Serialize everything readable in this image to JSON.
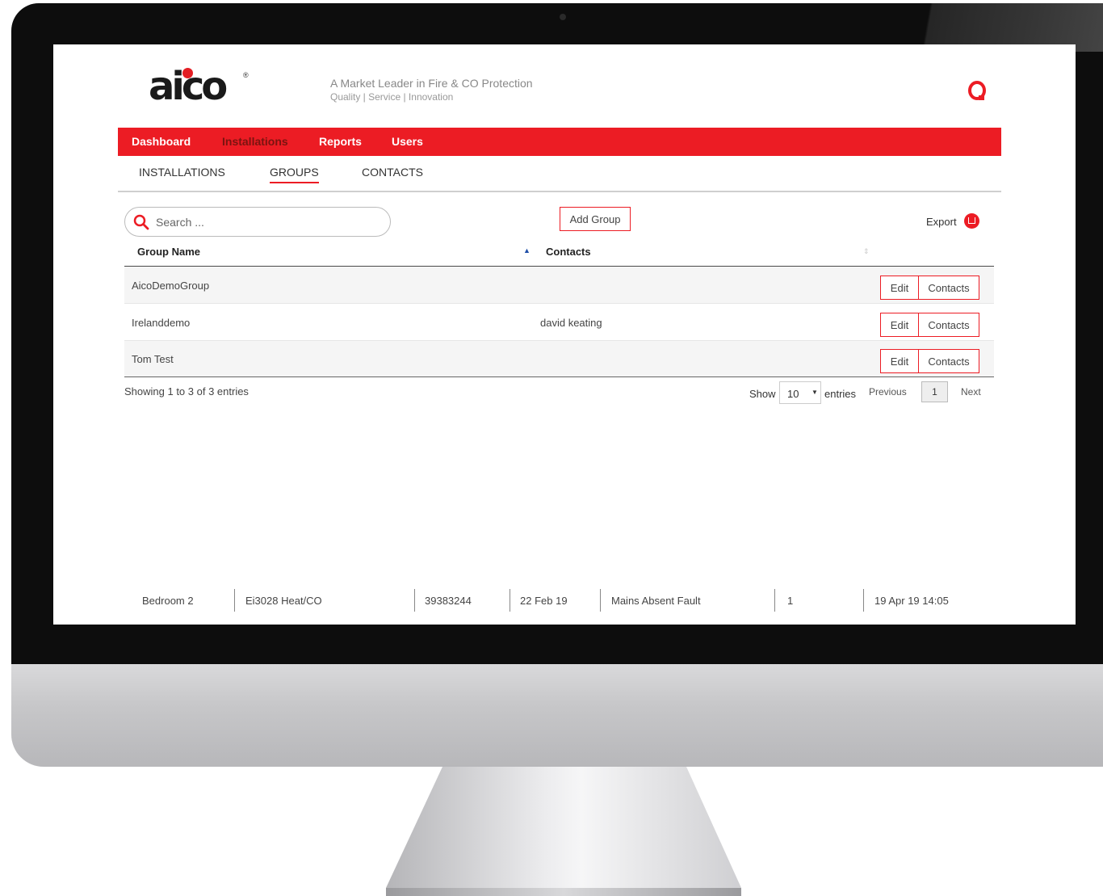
{
  "header": {
    "logo_text": "aico",
    "logo_mark": "®",
    "tagline": "A Market Leader in Fire & CO Protection",
    "tagline_sub": "Quality | Service | Innovation",
    "user_icon": "user-circle-icon"
  },
  "nav": {
    "items": [
      {
        "label": "Dashboard",
        "active": false
      },
      {
        "label": "Installations",
        "active": true
      },
      {
        "label": "Reports",
        "active": false
      },
      {
        "label": "Users",
        "active": false
      }
    ]
  },
  "subtabs": [
    {
      "label": "INSTALLATIONS",
      "active": false
    },
    {
      "label": "GROUPS",
      "active": true
    },
    {
      "label": "CONTACTS",
      "active": false
    }
  ],
  "toolbar": {
    "search_placeholder": "Search ...",
    "add_group_label": "Add Group",
    "export_label": "Export"
  },
  "table": {
    "columns": [
      "Group Name",
      "Contacts"
    ],
    "rows": [
      {
        "group_name": "AicoDemoGroup",
        "contacts": ""
      },
      {
        "group_name": "Irelanddemo",
        "contacts": "david keating"
      },
      {
        "group_name": "Tom Test",
        "contacts": ""
      }
    ],
    "edit_label": "Edit",
    "contacts_label": "Contacts"
  },
  "pagination": {
    "summary": "Showing 1 to 3 of 3 entries",
    "show_label": "Show",
    "page_size": "10",
    "entries_label": "entries",
    "previous_label": "Previous",
    "current_page": "1",
    "next_label": "Next"
  },
  "background_row": {
    "cells": [
      "Bedroom 2",
      "Ei3028 Heat/CO",
      "39383244",
      "22 Feb 19",
      "Mains Absent Fault",
      "1",
      "19 Apr 19 14:05"
    ]
  },
  "colors": {
    "brand_red": "#ec1c24",
    "active_nav": "#7a1410"
  }
}
